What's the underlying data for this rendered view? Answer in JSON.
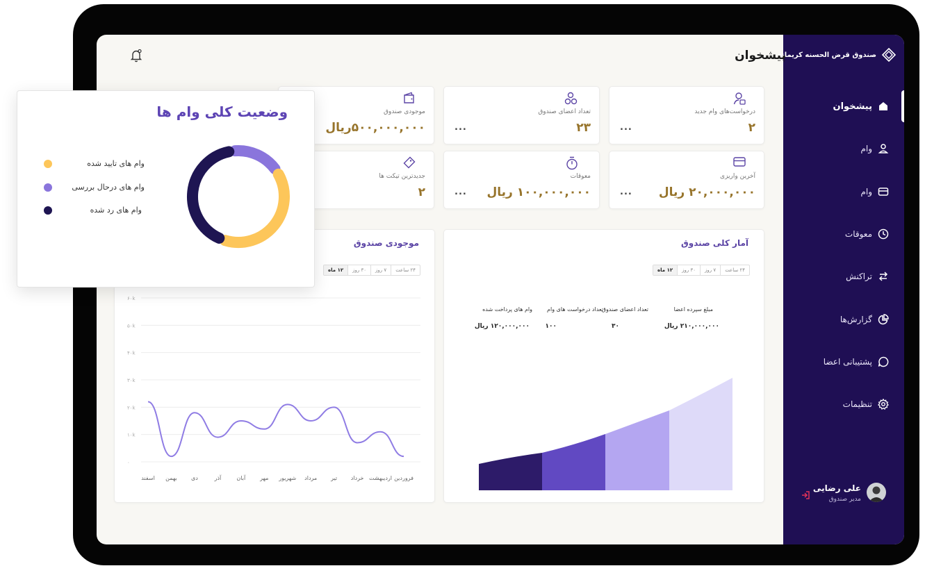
{
  "sidebar": {
    "brand": "صندوق قرض الحسنه کریمانه",
    "items": [
      {
        "label": "پیشخوان",
        "icon": "home-icon",
        "active": true
      },
      {
        "label": "وام",
        "icon": "user-icon"
      },
      {
        "label": "وام",
        "icon": "card-icon"
      },
      {
        "label": "معوقات",
        "icon": "clock-icon"
      },
      {
        "label": "تراکنش",
        "icon": "transfer-icon"
      },
      {
        "label": "گزارش‌ها",
        "icon": "pie-icon"
      },
      {
        "label": "پشتیبانی اعضا",
        "icon": "chat-icon"
      },
      {
        "label": "تنظیمات",
        "icon": "gear-icon"
      }
    ],
    "user": {
      "name": "علی رضایی",
      "role": "مدیر صندوق"
    }
  },
  "header": {
    "title": "پیشخوان"
  },
  "stats": [
    {
      "label": "درخواست‌های وام جدید",
      "value": "۲",
      "icon": "user-request-icon",
      "more": "..."
    },
    {
      "label": "تعداد اعضای صندوق",
      "value": "۲۳",
      "icon": "members-icon",
      "more": "..."
    },
    {
      "label": "موجودی صندوق",
      "value": "۵۰۰,۰۰۰,۰۰۰ریال",
      "icon": "wallet-icon",
      "more": ""
    },
    {
      "label": "آخرین واریزی",
      "value": "۲۰,۰۰۰,۰۰۰ ریال",
      "icon": "card-icon",
      "more": "..."
    },
    {
      "label": "معوقات",
      "value": "۱۰۰,۰۰۰,۰۰۰ ریال",
      "icon": "timer-icon",
      "more": "..."
    },
    {
      "label": "جدیدترین تیکت ها",
      "value": "۲",
      "icon": "ticket-icon",
      "more": ""
    }
  ],
  "fund_stats": {
    "title": "آمار کلی صندوق",
    "ranges": [
      "۲۴ ساعت",
      "۷ روز",
      "۳۰ روز",
      "۱۲ ماه"
    ],
    "selected_range": "۱۲ ماه",
    "metrics": [
      {
        "label": "مبلغ سپرده اعضا",
        "value": "۲۱۰,۰۰۰,۰۰۰ ریال"
      },
      {
        "label": "تعداد اعضای صندوق",
        "value": "۳۰"
      },
      {
        "label": "تعداد درخواست های وام",
        "value": "۱۰۰"
      },
      {
        "label": "وام های پرداخت شده",
        "value": "۱۲۰,۰۰۰,۰۰۰ ریال"
      }
    ],
    "colors": [
      "#2d1b69",
      "#6149c2",
      "#b4a6f1",
      "#dedaf9"
    ]
  },
  "balance_chart": {
    "title": "موجودی صندوق",
    "ranges": [
      "۲۴ ساعت",
      "۷ روز",
      "۳۰ روز",
      "۱۲ ماه"
    ],
    "selected_range": "۱۲ ماه",
    "line_color": "#8f7ce4"
  },
  "chart_data": [
    {
      "type": "line",
      "title": "موجودی صندوق",
      "x": [
        "فروردین",
        "اردیبهشت",
        "خرداد",
        "تیر",
        "مرداد",
        "شهریور",
        "مهر",
        "آبان",
        "آذر",
        "دی",
        "بهمن",
        "اسفند"
      ],
      "x_direction": "rtl",
      "ylim": [
        0,
        60000
      ],
      "y_ticks": [
        "۰",
        "۱۰k",
        "۲۰k",
        "۳۰k",
        "۴۰k",
        "۵۰k",
        "۶۰k"
      ],
      "series": [
        {
          "values": [
            2000,
            11000,
            7000,
            20000,
            15000,
            21000,
            12000,
            15000,
            9000,
            18000,
            2000,
            22000
          ]
        }
      ],
      "grid": true
    },
    {
      "type": "pie",
      "title": "وضعیت کلی وام ها",
      "categories": [
        "وام های تایید شده",
        "وام های درحال بررسی",
        "وام های رد شده"
      ],
      "values": [
        40,
        18,
        42
      ],
      "colors": [
        "#fdc65a",
        "#8a75dc",
        "#1e1552"
      ]
    }
  ],
  "popup": {
    "title": "وضعیت کلی وام ها"
  }
}
